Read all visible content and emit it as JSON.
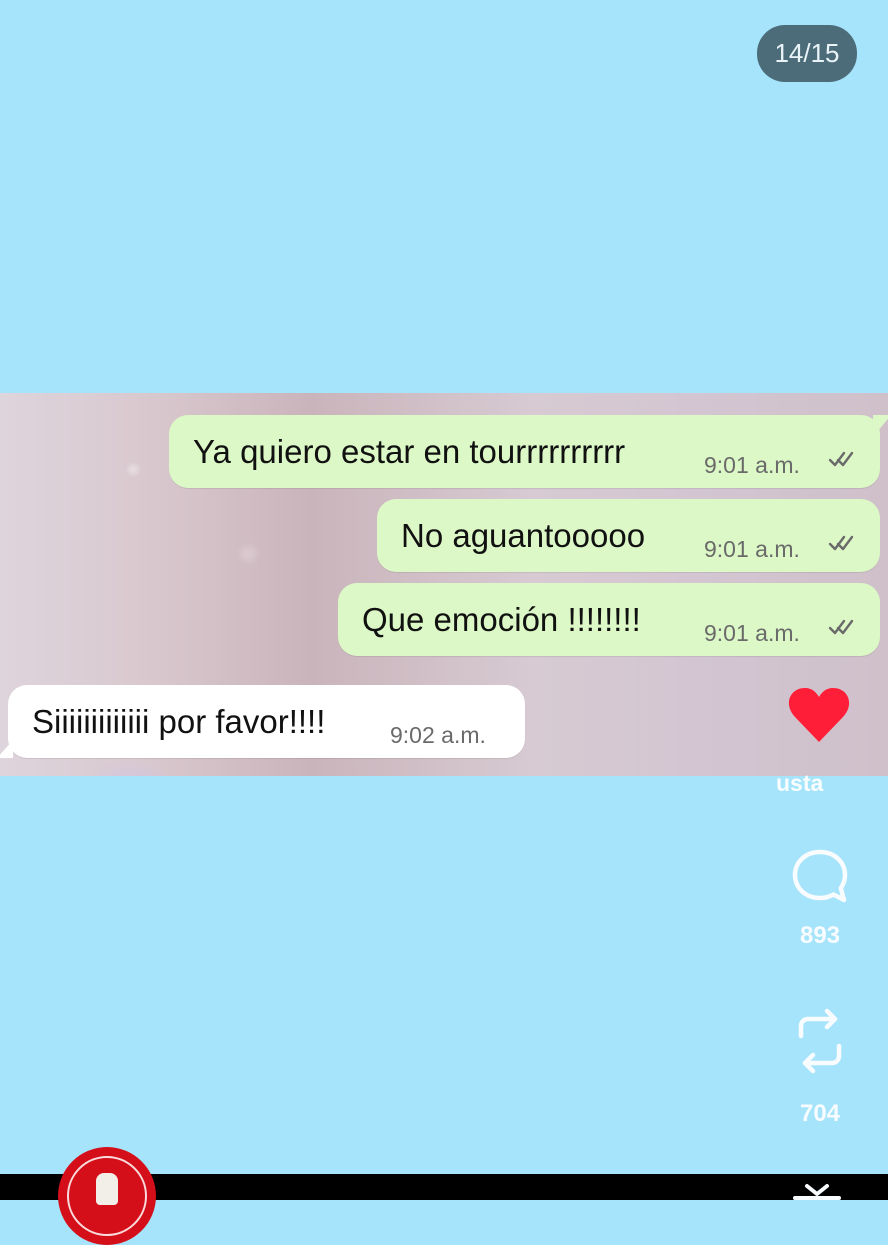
{
  "pager": {
    "label": "14/15"
  },
  "chat_screenshot": {
    "messages": [
      {
        "text": "Ya quiero estar en tourrrrrrrrrr",
        "time": "9:01 a.m."
      },
      {
        "text": "No aguantooooo",
        "time": "9:01 a.m."
      },
      {
        "text": "Que emoción !!!!!!!!",
        "time": "9:01 a.m."
      },
      {
        "text": "Siiiiiiiiiiiii por favor!!!!",
        "time": "9:02 a.m."
      }
    ]
  },
  "actions": {
    "like_label": "usta",
    "comment_count": "893",
    "repost_count": "704"
  },
  "colors": {
    "background": "#a6e4fb",
    "outgoing_bubble": "#dcf8c6",
    "incoming_bubble": "#ffffff",
    "heart": "#ff1e37"
  },
  "icons": {
    "like": "heart-icon",
    "comment": "comment-icon",
    "repost": "repost-icon",
    "check": "double-check-icon"
  }
}
